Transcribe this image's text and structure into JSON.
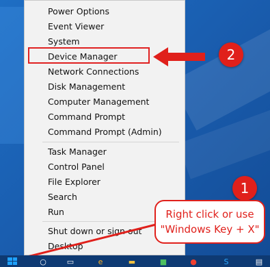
{
  "menu": {
    "items": [
      {
        "label": "Power Options"
      },
      {
        "label": "Event Viewer"
      },
      {
        "label": "System"
      },
      {
        "label": "Device Manager"
      },
      {
        "label": "Network Connections"
      },
      {
        "label": "Disk Management"
      },
      {
        "label": "Computer Management"
      },
      {
        "label": "Command Prompt"
      },
      {
        "label": "Command Prompt (Admin)"
      },
      {
        "label": "Task Manager"
      },
      {
        "label": "Control Panel"
      },
      {
        "label": "File Explorer"
      },
      {
        "label": "Search"
      },
      {
        "label": "Run"
      },
      {
        "label": "Shut down or sign out"
      },
      {
        "label": "Desktop"
      }
    ]
  },
  "annotations": {
    "badge_1": "1",
    "badge_2": "2",
    "callout_line1": "Right click or use",
    "callout_line2": "\"Windows Key + X\"",
    "accent_color": "#e0201b"
  },
  "taskbar": {
    "icons": [
      "start-button",
      "search-icon",
      "task-view-icon",
      "internet-explorer-icon",
      "file-explorer-icon",
      "store-icon",
      "chrome-icon",
      "app-icon",
      "skype-icon",
      "app-icon",
      "app-icon"
    ]
  }
}
